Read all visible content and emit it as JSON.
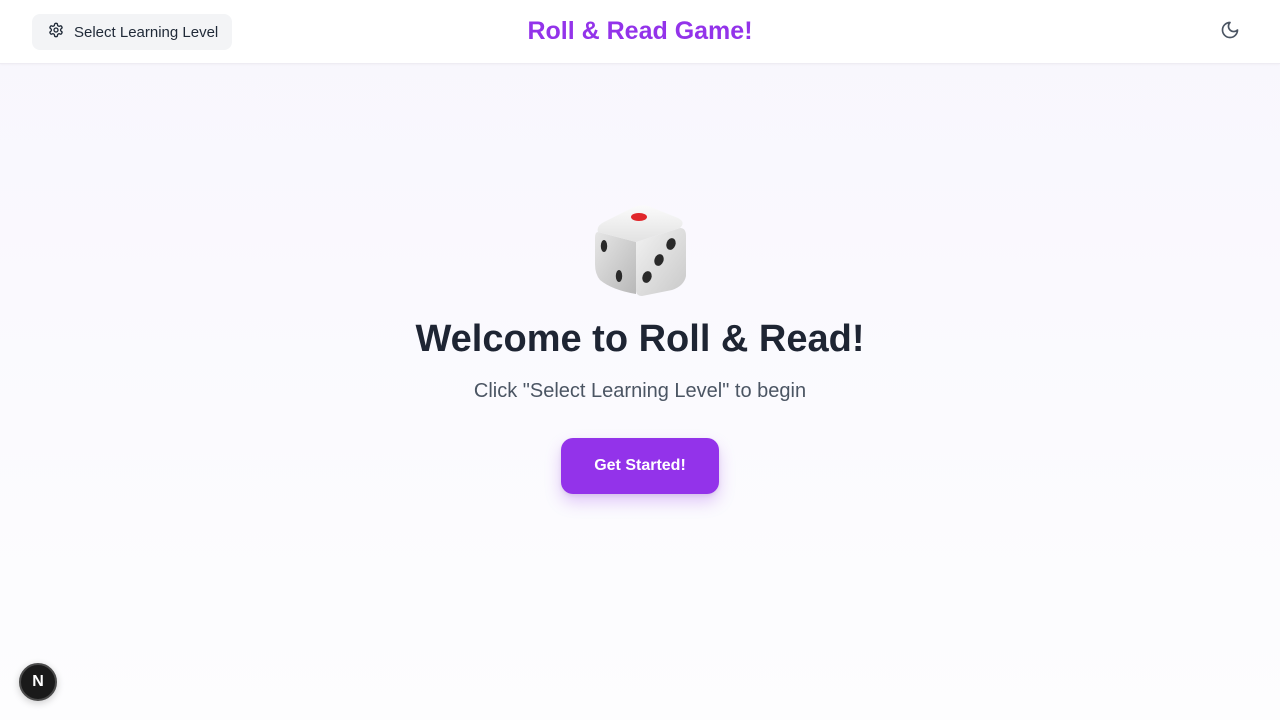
{
  "header": {
    "level_button": {
      "label": "Select Learning Level",
      "icon": "gear-icon"
    },
    "title": "Roll & Read Game!",
    "theme_toggle": {
      "icon": "moon-icon"
    }
  },
  "hero": {
    "icon": "dice-icon",
    "heading": "Welcome to Roll & Read!",
    "subtitle": "Click \"Select Learning Level\" to begin",
    "cta_label": "Get Started!"
  },
  "dev_badge": {
    "label": "N",
    "icon": "nextjs-logo-icon"
  },
  "colors": {
    "accent": "#9333ea",
    "heading": "#1e2533",
    "subtitle": "#4b5563",
    "button_bg": "#f3f4f6"
  }
}
